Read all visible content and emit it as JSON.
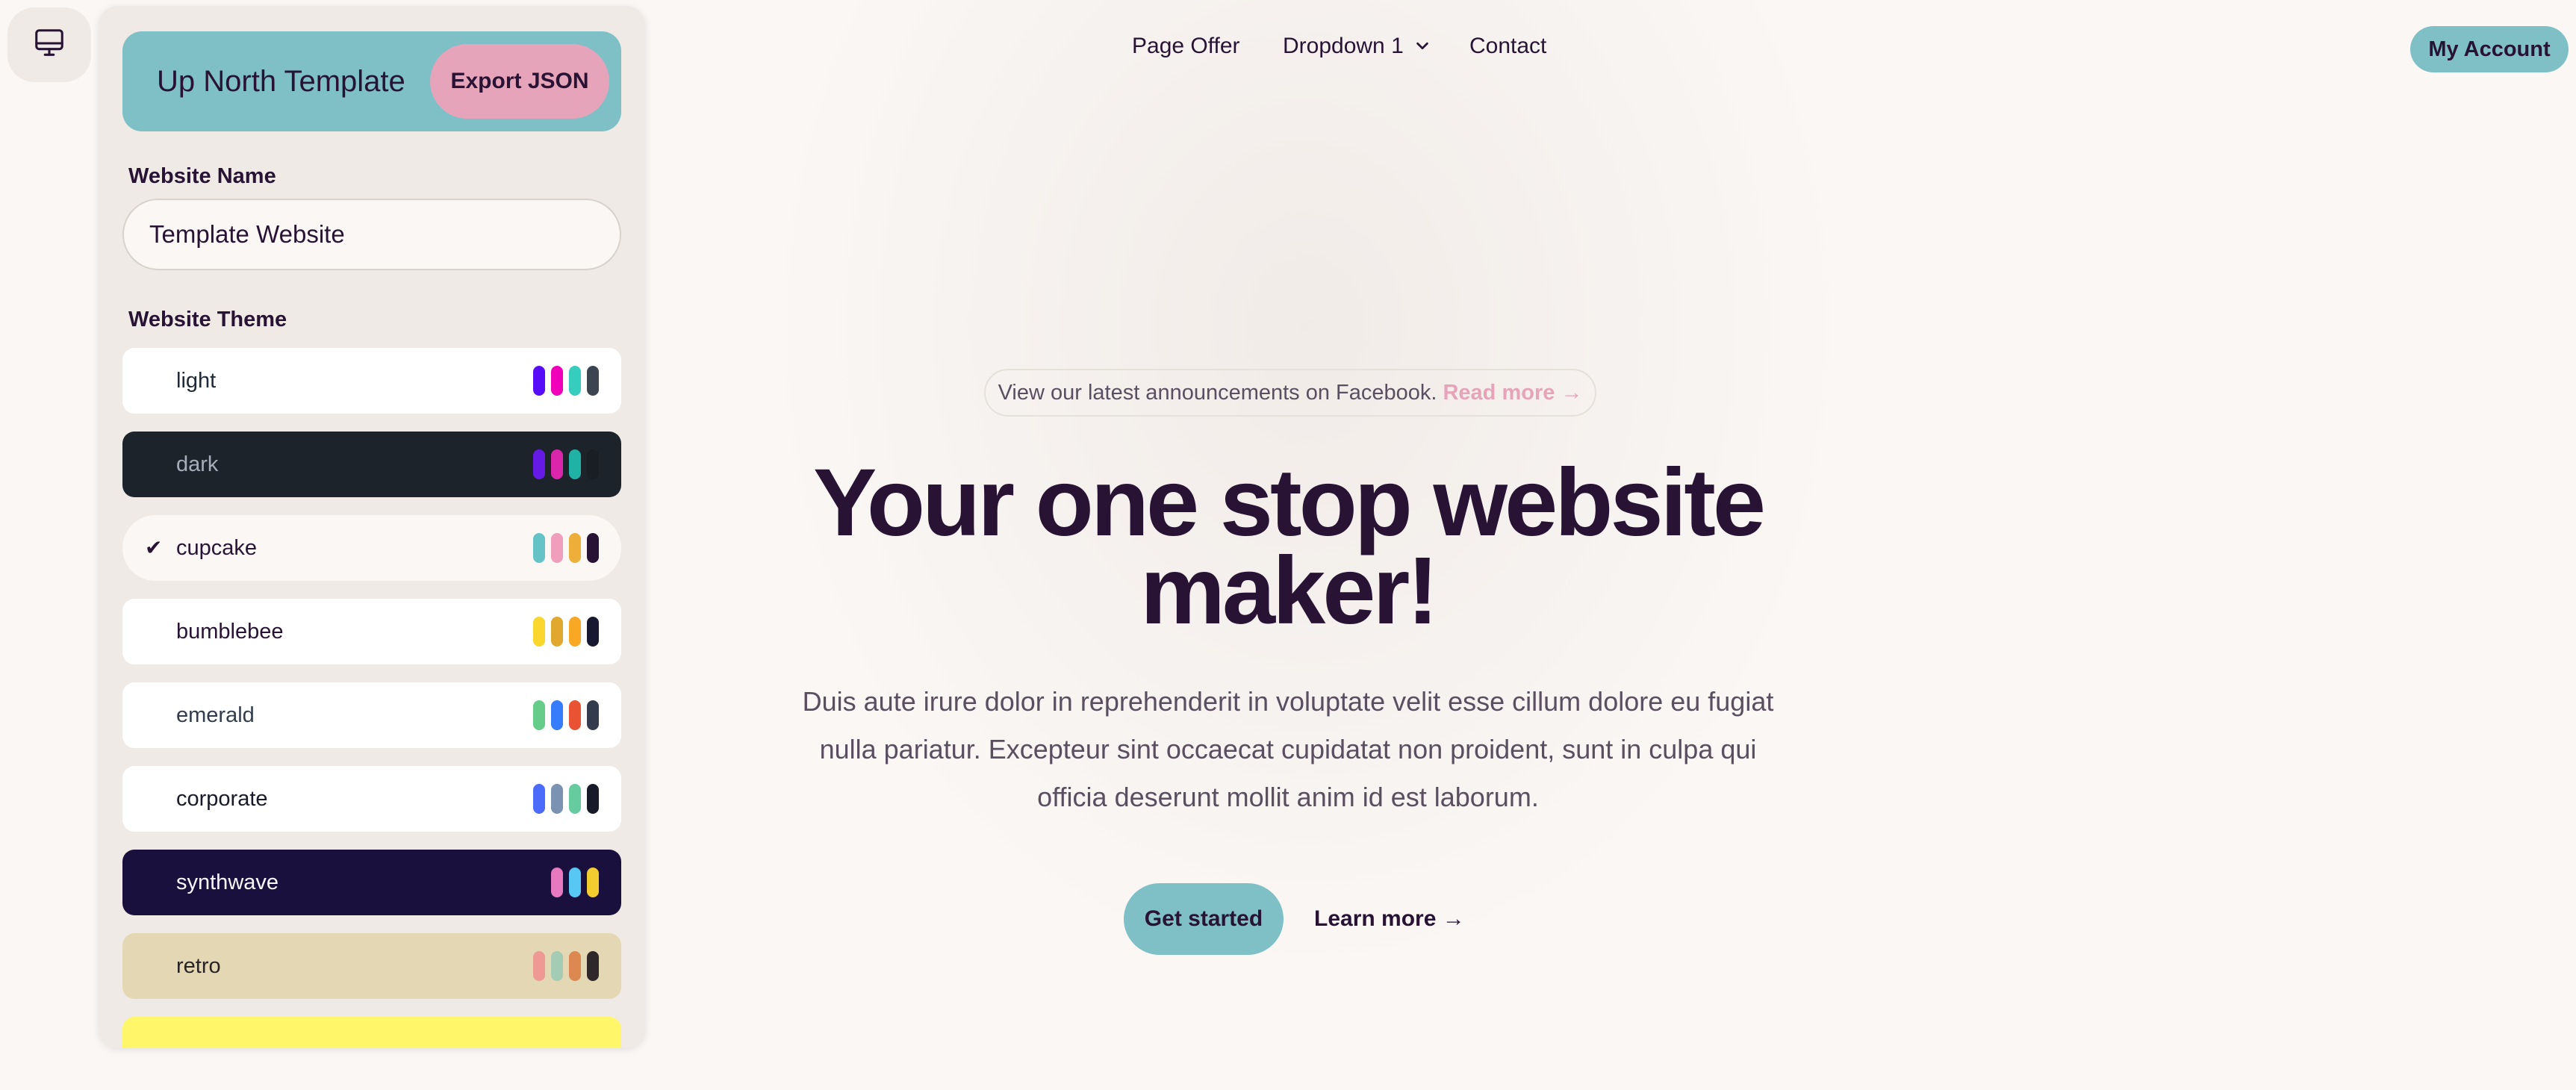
{
  "panel": {
    "title": "Up North Template",
    "export_label": "Export JSON",
    "website_name_label": "Website Name",
    "website_name_value": "Template Website",
    "website_theme_label": "Website Theme",
    "selected_theme": "cupcake",
    "themes": [
      {
        "name": "light",
        "bg": "#ffffff",
        "fg": "#1f2937",
        "selected": false,
        "swatches": [
          "#570df8",
          "#f000b8",
          "#37cdbe",
          "#3d4451"
        ]
      },
      {
        "name": "dark",
        "bg": "#1d232a",
        "fg": "#a6adbb",
        "selected": false,
        "swatches": [
          "#661ae6",
          "#d926aa",
          "#1fb2a5",
          "#191d24"
        ]
      },
      {
        "name": "cupcake",
        "bg": "#faf7f5",
        "fg": "#291334",
        "selected": true,
        "check_icon": "check-icon",
        "swatches": [
          "#65c3c8",
          "#ef9fbc",
          "#eeaf3a",
          "#291334"
        ]
      },
      {
        "name": "bumblebee",
        "bg": "#ffffff",
        "fg": "#291334",
        "selected": false,
        "swatches": [
          "#f9d72f",
          "#e0a82e",
          "#f9a825",
          "#181830"
        ]
      },
      {
        "name": "emerald",
        "bg": "#ffffff",
        "fg": "#333c4d",
        "selected": false,
        "swatches": [
          "#66cc8a",
          "#377cfb",
          "#ea5234",
          "#333c4d"
        ]
      },
      {
        "name": "corporate",
        "bg": "#ffffff",
        "fg": "#181a2a",
        "selected": false,
        "swatches": [
          "#4b6bfb",
          "#7b92b2",
          "#67cba0",
          "#181a2a"
        ]
      },
      {
        "name": "synthwave",
        "bg": "#1a103d",
        "fg": "#f9f7fd",
        "selected": false,
        "swatches": [
          "#e779c1",
          "#58c7f3",
          "#f3cc30"
        ]
      },
      {
        "name": "retro",
        "bg": "#e4d8b4",
        "fg": "#282425",
        "selected": false,
        "swatches": [
          "#ef9995",
          "#a4cbb4",
          "#dc8850",
          "#2e282a"
        ]
      }
    ],
    "partial_theme_bg": "#fff669"
  },
  "toggle": {
    "icon": "monitor-icon"
  },
  "nav": {
    "links": [
      "Page Offer",
      "Dropdown 1",
      "Contact"
    ],
    "dropdown_icon": "chevron-down-icon",
    "account_label": "My Account"
  },
  "hero": {
    "announcement_text": "View our latest announcements on Facebook.",
    "announcement_link": "Read more →",
    "headline_line1": "Your one stop website",
    "headline_line2": "maker!",
    "lede": "Duis aute irure dolor in reprehenderit in voluptate velit esse cillum dolore eu fugiat nulla pariatur. Excepteur sint occaecat cupidatat non proident, sunt in culpa qui officia deserunt mollit anim id est laborum.",
    "primary_cta": "Get started",
    "secondary_cta": "Learn more →"
  },
  "colors": {
    "page_bg": "#faf7f5",
    "accent_teal": "#7fc0c7",
    "accent_pink": "#e6a4bb",
    "text_dark": "#291334"
  }
}
